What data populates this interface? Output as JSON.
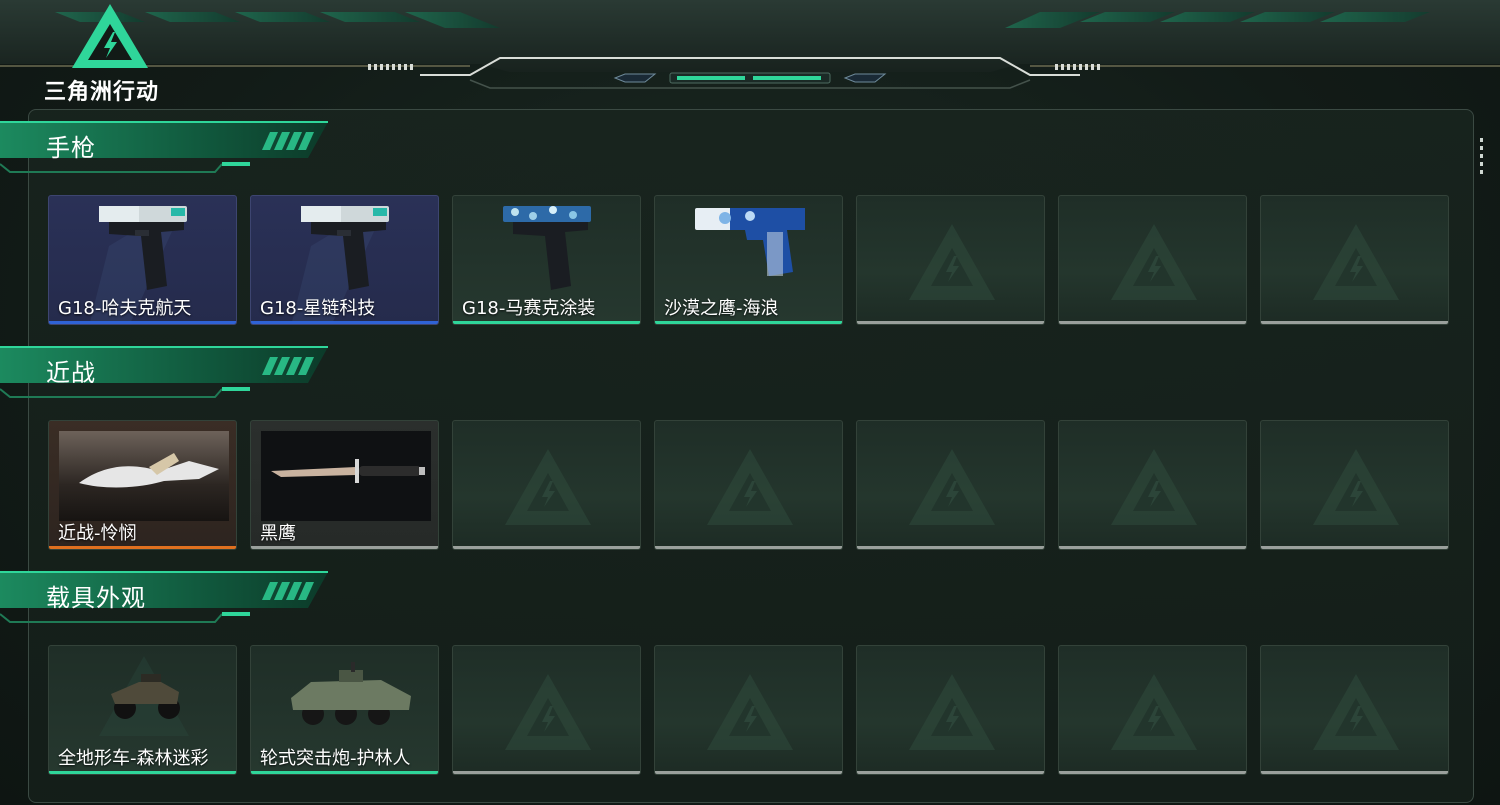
{
  "brand": {
    "name": "三角洲行动",
    "logo_icon": "delta-triangle-logo-icon"
  },
  "colors": {
    "accent": "#2fd69a",
    "rarity_blue": "#2f63d6",
    "rarity_green": "#2fd69a",
    "rarity_orange": "#e0701f",
    "rarity_gray": "#9aa09c"
  },
  "sections": [
    {
      "title": "手枪",
      "items": [
        {
          "label": "G18-哈夫克航天",
          "rarity": "blue",
          "icon": "pistol-g18-icon"
        },
        {
          "label": "G18-星链科技",
          "rarity": "blue",
          "icon": "pistol-g18-icon"
        },
        {
          "label": "G18-马赛克涂装",
          "rarity": "green",
          "icon": "pistol-g18-mosaic-icon"
        },
        {
          "label": "沙漠之鹰-海浪",
          "rarity": "green",
          "icon": "pistol-deagle-icon"
        },
        {
          "label": "",
          "rarity": "empty"
        },
        {
          "label": "",
          "rarity": "empty"
        },
        {
          "label": "",
          "rarity": "empty"
        }
      ]
    },
    {
      "title": "近战",
      "items": [
        {
          "label": "近战-怜悯",
          "rarity": "orange",
          "icon": "karambit-knife-icon"
        },
        {
          "label": "黑鹰",
          "rarity": "gray",
          "icon": "combat-knife-icon"
        },
        {
          "label": "",
          "rarity": "empty"
        },
        {
          "label": "",
          "rarity": "empty"
        },
        {
          "label": "",
          "rarity": "empty"
        },
        {
          "label": "",
          "rarity": "empty"
        },
        {
          "label": "",
          "rarity": "empty"
        }
      ]
    },
    {
      "title": "载具外观",
      "items": [
        {
          "label": "全地形车-森林迷彩",
          "rarity": "green",
          "icon": "atv-vehicle-icon"
        },
        {
          "label": "轮式突击炮-护林人",
          "rarity": "green",
          "icon": "armored-vehicle-icon"
        },
        {
          "label": "",
          "rarity": "empty"
        },
        {
          "label": "",
          "rarity": "empty"
        },
        {
          "label": "",
          "rarity": "empty"
        },
        {
          "label": "",
          "rarity": "empty"
        },
        {
          "label": "",
          "rarity": "empty"
        }
      ]
    }
  ]
}
